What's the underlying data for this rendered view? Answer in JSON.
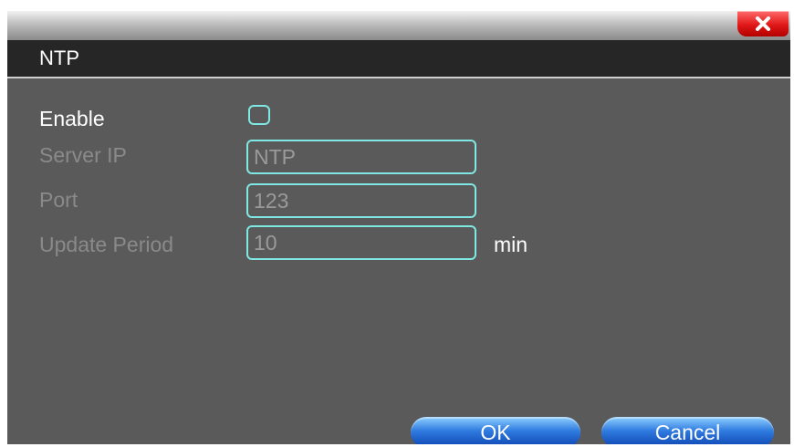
{
  "dialog": {
    "title": "NTP"
  },
  "form": {
    "enable_label": "Enable",
    "enable_checked": false,
    "server_ip_label": "Server IP",
    "server_ip_value": "NTP",
    "port_label": "Port",
    "port_value": "123",
    "update_period_label": "Update Period",
    "update_period_value": "10",
    "update_period_unit": "min"
  },
  "buttons": {
    "ok_label": "OK",
    "cancel_label": "Cancel"
  },
  "colors": {
    "panel": "#5a5a5a",
    "title_bar": "#262626",
    "field_border": "#7fe8e2",
    "close_button": "#e01818",
    "button_blue": "#2f7be0"
  }
}
